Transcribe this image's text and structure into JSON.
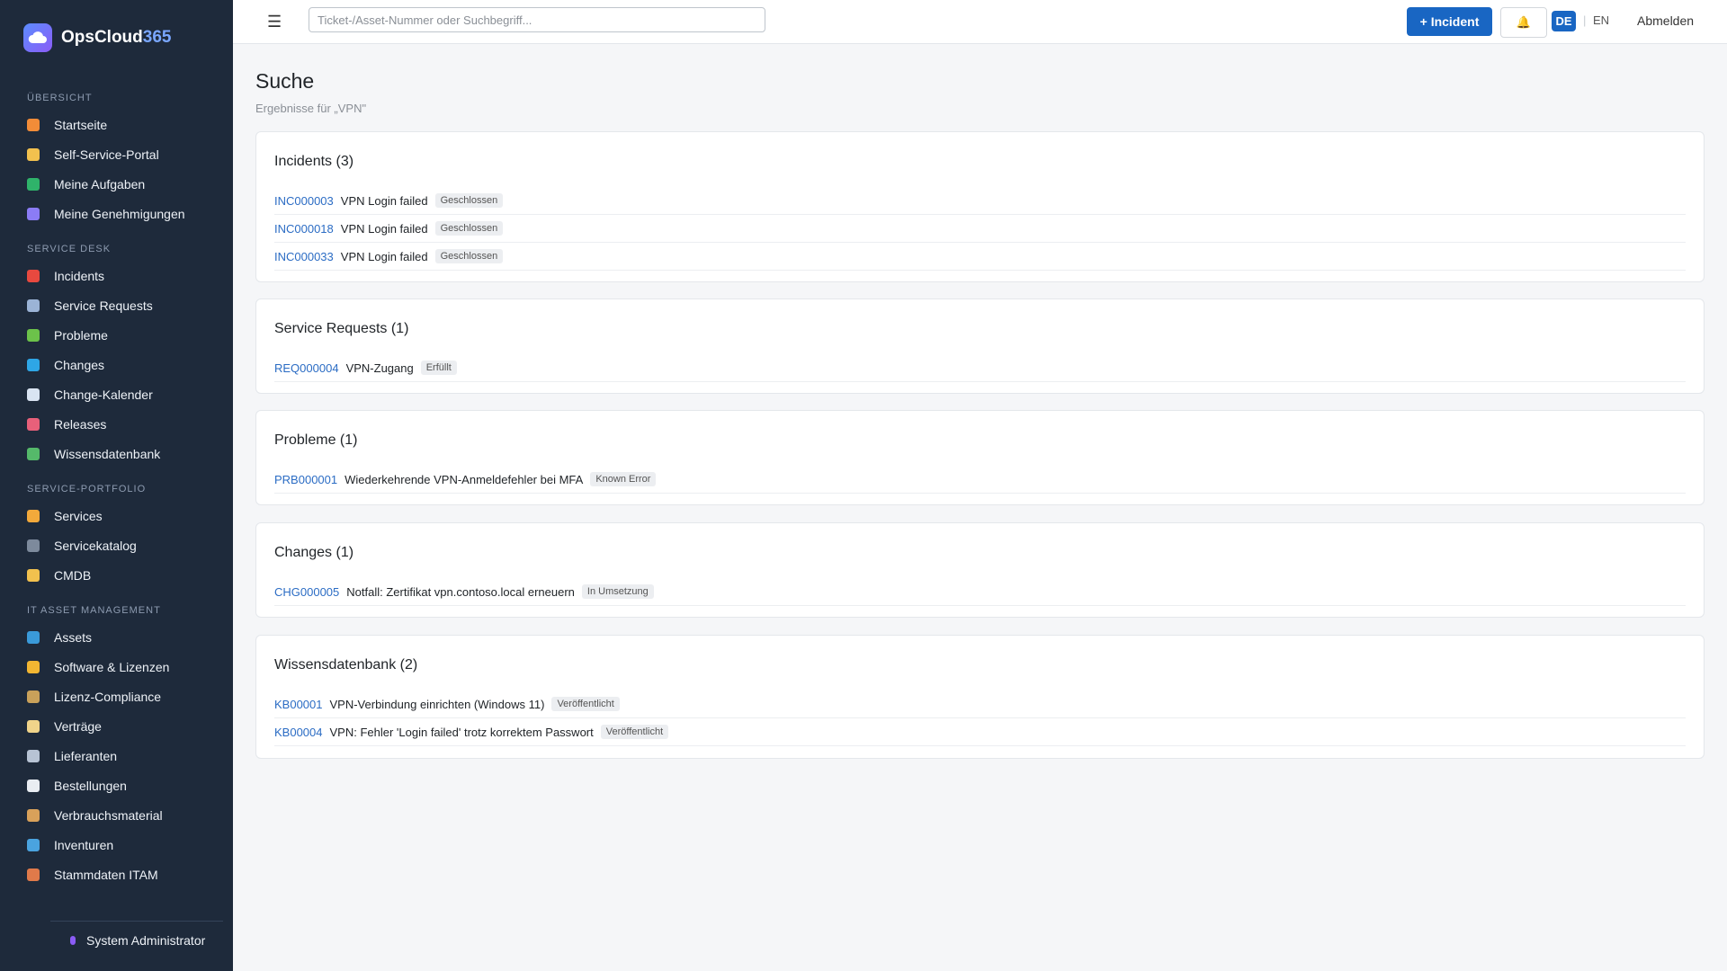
{
  "brand": {
    "name_main": "OpsCloud",
    "name_accent": "365"
  },
  "sidebar": {
    "sections": [
      {
        "heading": "Übersicht",
        "items": [
          {
            "label": "Startseite",
            "icon": "home-icon",
            "color": "#f28c38"
          },
          {
            "label": "Self-Service-Portal",
            "icon": "person-icon",
            "color": "#f2c14e"
          },
          {
            "label": "Meine Aufgaben",
            "icon": "checkbox-icon",
            "color": "#2fb36a"
          },
          {
            "label": "Meine Genehmigungen",
            "icon": "checkmark-icon",
            "color": "#8b7cf6"
          }
        ]
      },
      {
        "heading": "Service Desk",
        "items": [
          {
            "label": "Incidents",
            "icon": "siren-icon",
            "color": "#e8493f"
          },
          {
            "label": "Service Requests",
            "icon": "envelope-icon",
            "color": "#9bb3d6"
          },
          {
            "label": "Probleme",
            "icon": "puzzle-icon",
            "color": "#6cc24a"
          },
          {
            "label": "Changes",
            "icon": "refresh-icon",
            "color": "#2ea6e6"
          },
          {
            "label": "Change-Kalender",
            "icon": "calendar-icon",
            "color": "#d9e4f2"
          },
          {
            "label": "Releases",
            "icon": "rocket-icon",
            "color": "#e8607a"
          },
          {
            "label": "Wissensdatenbank",
            "icon": "books-icon",
            "color": "#55b96a"
          }
        ]
      },
      {
        "heading": "Service-Portfolio",
        "items": [
          {
            "label": "Services",
            "icon": "bell-icon",
            "color": "#f2a93b"
          },
          {
            "label": "Servicekatalog",
            "icon": "keyboard-icon",
            "color": "#7d8a9c"
          },
          {
            "label": "CMDB",
            "icon": "folder-icon",
            "color": "#f2c14e"
          }
        ]
      },
      {
        "heading": "IT Asset Management",
        "items": [
          {
            "label": "Assets",
            "icon": "laptop-icon",
            "color": "#3a9ad9"
          },
          {
            "label": "Software & Lizenzen",
            "icon": "disc-icon",
            "color": "#f2b632"
          },
          {
            "label": "Lizenz-Compliance",
            "icon": "scale-icon",
            "color": "#c9a15a"
          },
          {
            "label": "Verträge",
            "icon": "scroll-icon",
            "color": "#f0d48a"
          },
          {
            "label": "Lieferanten",
            "icon": "building-icon",
            "color": "#b7c3d4"
          },
          {
            "label": "Bestellungen",
            "icon": "receipt-icon",
            "color": "#e9edf2"
          },
          {
            "label": "Verbrauchsmaterial",
            "icon": "box-icon",
            "color": "#d9a15a"
          },
          {
            "label": "Inventuren",
            "icon": "magnifier-icon",
            "color": "#4aa3df"
          },
          {
            "label": "Stammdaten ITAM",
            "icon": "bricks-icon",
            "color": "#e07a4a"
          }
        ]
      }
    ],
    "user": "System Administrator"
  },
  "topbar": {
    "menu_icon": "☰",
    "search_placeholder": "Ticket-/Asset-Nummer oder Suchbegriff...",
    "new_incident_label": "+ Incident",
    "bell_icon": "🔔",
    "lang_de": "DE",
    "lang_separator": "|",
    "lang_en": "EN",
    "logout_label": "Abmelden"
  },
  "page": {
    "title": "Suche",
    "subtitle": "Ergebnisse für „VPN\""
  },
  "results": [
    {
      "title": "Incidents (3)",
      "rows": [
        {
          "id": "INC000003",
          "title": "VPN Login failed",
          "status": "Geschlossen"
        },
        {
          "id": "INC000018",
          "title": "VPN Login failed",
          "status": "Geschlossen"
        },
        {
          "id": "INC000033",
          "title": "VPN Login failed",
          "status": "Geschlossen"
        }
      ]
    },
    {
      "title": "Service Requests (1)",
      "rows": [
        {
          "id": "REQ000004",
          "title": "VPN-Zugang",
          "status": "Erfüllt"
        }
      ]
    },
    {
      "title": "Probleme (1)",
      "rows": [
        {
          "id": "PRB000001",
          "title": "Wiederkehrende VPN-Anmeldefehler bei MFA",
          "status": "Known Error"
        }
      ]
    },
    {
      "title": "Changes (1)",
      "rows": [
        {
          "id": "CHG000005",
          "title": "Notfall: Zertifikat vpn.contoso.local erneuern",
          "status": "In Umsetzung"
        }
      ]
    },
    {
      "title": "Wissensdatenbank (2)",
      "rows": [
        {
          "id": "KB00001",
          "title": "VPN-Verbindung einrichten (Windows 11)",
          "status": "Veröffentlicht"
        },
        {
          "id": "KB00004",
          "title": "VPN: Fehler 'Login failed' trotz korrektem Passwort",
          "status": "Veröffentlicht"
        }
      ]
    }
  ],
  "colors": {
    "sidebar_bg": "#1e2a3b",
    "primary": "#1966c3",
    "link": "#2b6cc4",
    "page_bg": "#f5f6f8"
  }
}
